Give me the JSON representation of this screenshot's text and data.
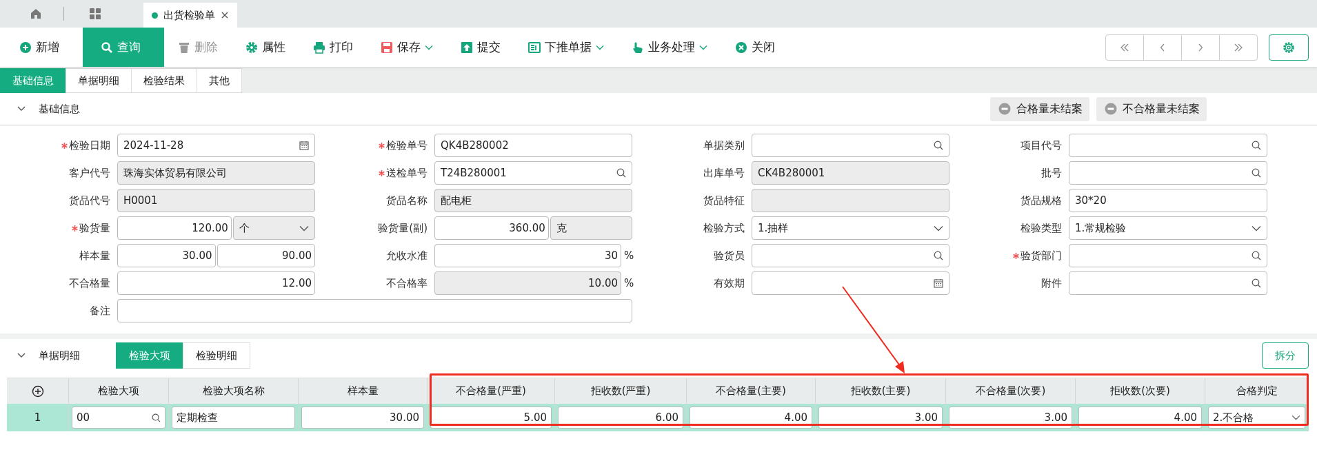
{
  "window_tabs": [
    {
      "kind": "home",
      "selected": false
    },
    {
      "kind": "grid",
      "selected": false
    },
    {
      "kind": "document",
      "label": "出货检验单",
      "selected": true
    }
  ],
  "toolbar": [
    {
      "label": "新增",
      "active": false,
      "disabled": false,
      "dropdown": false
    },
    {
      "label": "查询",
      "active": true,
      "disabled": false,
      "dropdown": false
    },
    {
      "label": "删除",
      "active": false,
      "disabled": true,
      "dropdown": false
    },
    {
      "label": "属性",
      "active": false,
      "disabled": false,
      "dropdown": false
    },
    {
      "label": "打印",
      "active": false,
      "disabled": false,
      "dropdown": false
    },
    {
      "label": "保存",
      "active": false,
      "disabled": false,
      "dropdown": true
    },
    {
      "label": "提交",
      "active": false,
      "disabled": false,
      "dropdown": false
    },
    {
      "label": "下推单据",
      "active": false,
      "disabled": false,
      "dropdown": true
    },
    {
      "label": "业务处理",
      "active": false,
      "disabled": false,
      "dropdown": true
    },
    {
      "label": "关闭",
      "active": false,
      "disabled": false,
      "dropdown": false
    }
  ],
  "section_tabs": [
    {
      "label": "基础信息",
      "selected": true
    },
    {
      "label": "单据明细",
      "selected": false
    },
    {
      "label": "检验结果",
      "selected": false
    },
    {
      "label": "其他",
      "selected": false
    }
  ],
  "basic_info": {
    "title": "基础信息",
    "expanded": true,
    "status_buttons": [
      "合格量未结案",
      "不合格量未结案"
    ],
    "rows": [
      [
        {
          "label": "检验日期",
          "required": true,
          "inputs": [
            {
              "kind": "date",
              "value": "2024-11-28",
              "readonly": false
            }
          ]
        },
        {
          "label": "检验单号",
          "required": true,
          "inputs": [
            {
              "kind": "text",
              "value": "QK4B280002",
              "readonly": false
            }
          ]
        },
        {
          "label": "单据类别",
          "required": false,
          "inputs": [
            {
              "kind": "search",
              "readonly": false
            }
          ]
        },
        {
          "label": "项目代号",
          "required": false,
          "inputs": [
            {
              "kind": "search",
              "readonly": false
            }
          ]
        }
      ],
      [
        {
          "label": "客户代号",
          "required": false,
          "inputs": [
            {
              "kind": "text",
              "value": "珠海实体贸易有限公司",
              "readonly": true
            }
          ]
        },
        {
          "label": "送检单号",
          "required": true,
          "inputs": [
            {
              "kind": "search",
              "value": "T24B280001",
              "readonly": false
            }
          ]
        },
        {
          "label": "出库单号",
          "required": false,
          "inputs": [
            {
              "kind": "text",
              "value": "CK4B280001",
              "readonly": true
            }
          ]
        },
        {
          "label": "批号",
          "required": false,
          "inputs": [
            {
              "kind": "search",
              "readonly": false
            }
          ]
        }
      ],
      [
        {
          "label": "货品代号",
          "required": false,
          "inputs": [
            {
              "kind": "text",
              "value": "H0001",
              "readonly": true
            }
          ]
        },
        {
          "label": "货品名称",
          "required": false,
          "inputs": [
            {
              "kind": "text",
              "value": "配电柜",
              "readonly": true
            }
          ]
        },
        {
          "label": "货品特征",
          "required": false,
          "inputs": [
            {
              "kind": "text",
              "readonly": true
            }
          ]
        },
        {
          "label": "货品规格",
          "required": false,
          "inputs": [
            {
              "kind": "text",
              "value": "30*20",
              "readonly": false
            }
          ]
        }
      ],
      [
        {
          "label": "验货量",
          "required": true,
          "inputs": [
            {
              "kind": "number",
              "value": "120.00",
              "readonly": false
            },
            {
              "kind": "select",
              "value": "个",
              "readonly": true
            }
          ]
        },
        {
          "label": "验货量(副)",
          "required": false,
          "inputs": [
            {
              "kind": "number",
              "value": "360.00",
              "readonly": false
            },
            {
              "kind": "text",
              "value": "克",
              "readonly": true
            }
          ]
        },
        {
          "label": "检验方式",
          "required": false,
          "inputs": [
            {
              "kind": "select",
              "value": "1.抽样",
              "readonly": false
            }
          ]
        },
        {
          "label": "检验类型",
          "required": false,
          "inputs": [
            {
              "kind": "select",
              "value": "1.常规检验",
              "readonly": false
            }
          ]
        }
      ],
      [
        {
          "label": "样本量",
          "required": false,
          "inputs": [
            {
              "kind": "number",
              "value": "30.00",
              "readonly": false
            },
            {
              "kind": "number",
              "value": "90.00",
              "readonly": false
            }
          ]
        },
        {
          "label": "允收水准",
          "required": false,
          "suffix": "%",
          "inputs": [
            {
              "kind": "number",
              "value": "30",
              "readonly": false
            }
          ]
        },
        {
          "label": "验货员",
          "required": false,
          "inputs": [
            {
              "kind": "search",
              "readonly": false
            }
          ]
        },
        {
          "label": "验货部门",
          "required": true,
          "inputs": [
            {
              "kind": "search",
              "readonly": false
            }
          ]
        }
      ],
      [
        {
          "label": "不合格量",
          "required": false,
          "inputs": [
            {
              "kind": "number",
              "value": "12.00",
              "readonly": false
            }
          ]
        },
        {
          "label": "不合格率",
          "required": false,
          "suffix": "%",
          "inputs": [
            {
              "kind": "number",
              "value": "10.00",
              "readonly": true
            }
          ]
        },
        {
          "label": "有效期",
          "required": false,
          "inputs": [
            {
              "kind": "date",
              "readonly": false
            }
          ]
        },
        {
          "label": "附件",
          "required": false,
          "inputs": [
            {
              "kind": "search",
              "readonly": false
            }
          ]
        }
      ],
      [
        {
          "label": "备注",
          "required": false,
          "inputs": [
            {
              "kind": "memo",
              "readonly": false
            }
          ]
        }
      ]
    ]
  },
  "detail": {
    "title": "单据明细",
    "expanded": true,
    "tabs": [
      {
        "label": "检验大项",
        "selected": true
      },
      {
        "label": "检验明细",
        "selected": false
      }
    ],
    "split_button": "拆分",
    "columns": [
      "检验大项",
      "检验大项名称",
      "样本量",
      "不合格量(严重)",
      "拒收数(严重)",
      "不合格量(主要)",
      "拒收数(主要)",
      "不合格量(次要)",
      "拒收数(次要)",
      "合格判定"
    ],
    "rows": [
      {
        "index": "1",
        "selected": true,
        "cells": [
          {
            "kind": "search",
            "value": "00"
          },
          {
            "kind": "text",
            "value": "定期检查"
          },
          {
            "kind": "number",
            "value": "30.00"
          },
          {
            "kind": "number",
            "value": "5.00"
          },
          {
            "kind": "number",
            "value": "6.00"
          },
          {
            "kind": "number",
            "value": "4.00"
          },
          {
            "kind": "number",
            "value": "3.00"
          },
          {
            "kind": "number",
            "value": "3.00"
          },
          {
            "kind": "number",
            "value": "4.00"
          },
          {
            "kind": "select",
            "value": "2.不合格"
          }
        ]
      }
    ]
  }
}
